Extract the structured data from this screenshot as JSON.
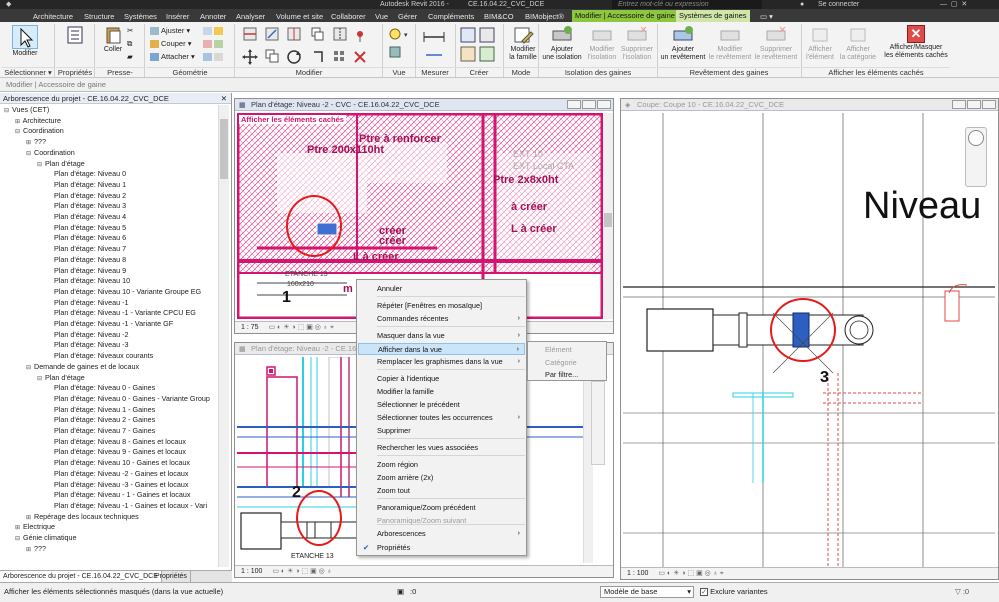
{
  "titlebar": {
    "app_title": "Autodesk Revit 2016 -",
    "file_name": "CE.16.04.22_CVC_DCE",
    "search_placeholder": "Entrez mot-clé ou expression",
    "signin": "Se connecter"
  },
  "tabs": [
    "Architecture",
    "Structure",
    "Systèmes",
    "Insérer",
    "Annoter",
    "Analyser",
    "Volume et site",
    "Collaborer",
    "Vue",
    "Gérer",
    "Compléments",
    "BIM&CO",
    "BIMobject®",
    "Modifier | Accessoire de gaine",
    "Systèmes de gaines"
  ],
  "ribbon": {
    "modify": "Modifier",
    "selection": "Sélectionner",
    "properties": "Propriétés",
    "clipboard": "Presse-papiers",
    "geometry": "Géométrie",
    "modify_panel": "Modifier",
    "view": "Vue",
    "measure": "Mesurer",
    "create": "Créer",
    "mode": "Mode",
    "insulation_panel": "Isolation des gaines",
    "lining_panel": "Revêtement des gaines",
    "hidden_panel": "Afficher les éléments cachés",
    "paste": "Coller",
    "cut": "Couper",
    "fit": "Ajuster",
    "attach": "Attacher",
    "edit_family_1": "Modifier",
    "edit_family_2": "la famille",
    "add_insul_1": "Ajouter",
    "add_insul_2": "une isolation",
    "mod_insul_1": "Modifier",
    "mod_insul_2": "l'isolation",
    "del_insul_1": "Supprimer",
    "del_insul_2": "l'isolation",
    "add_lining_1": "Ajouter",
    "add_lining_2": "un revêtement",
    "mod_lining_1": "Modifier",
    "mod_lining_2": "le revêtement",
    "del_lining_1": "Supprimer",
    "del_lining_2": "le revêtement",
    "show_elem_1": "Afficher",
    "show_elem_2": "l'élément",
    "show_cat_1": "Afficher",
    "show_cat_2": "la catégorie",
    "toggle_hidden_1": "Afficher/Masquer",
    "toggle_hidden_2": "les éléments cachés"
  },
  "optbar": "Modifier | Accessoire de gaine",
  "browser": {
    "title": "Arborescence du projet - CE.16.04.22_CVC_DCE",
    "items": [
      {
        "label": "Vues (CET)",
        "depth": 0,
        "tw": "⊟"
      },
      {
        "label": "Architecture",
        "depth": 1,
        "tw": "⊞"
      },
      {
        "label": "Coordination",
        "depth": 1,
        "tw": "⊟"
      },
      {
        "label": "???",
        "depth": 2,
        "tw": "⊞"
      },
      {
        "label": "Coordination",
        "depth": 2,
        "tw": "⊟"
      },
      {
        "label": "Plan d'étage",
        "depth": 3,
        "tw": "⊟"
      },
      {
        "label": "Plan d'étage: Niveau 0",
        "depth": 4,
        "tw": ""
      },
      {
        "label": "Plan d'étage: Niveau 1",
        "depth": 4,
        "tw": ""
      },
      {
        "label": "Plan d'étage: Niveau 2",
        "depth": 4,
        "tw": ""
      },
      {
        "label": "Plan d'étage: Niveau 3",
        "depth": 4,
        "tw": ""
      },
      {
        "label": "Plan d'étage: Niveau 4",
        "depth": 4,
        "tw": ""
      },
      {
        "label": "Plan d'étage: Niveau 5",
        "depth": 4,
        "tw": ""
      },
      {
        "label": "Plan d'étage: Niveau 6",
        "depth": 4,
        "tw": ""
      },
      {
        "label": "Plan d'étage: Niveau 7",
        "depth": 4,
        "tw": ""
      },
      {
        "label": "Plan d'étage: Niveau 8",
        "depth": 4,
        "tw": ""
      },
      {
        "label": "Plan d'étage: Niveau 9",
        "depth": 4,
        "tw": ""
      },
      {
        "label": "Plan d'étage: Niveau 10",
        "depth": 4,
        "tw": ""
      },
      {
        "label": "Plan d'étage: Niveau 10 - Variante Groupe EG",
        "depth": 4,
        "tw": ""
      },
      {
        "label": "Plan d'étage: Niveau -1",
        "depth": 4,
        "tw": ""
      },
      {
        "label": "Plan d'étage: Niveau -1 - Variante CPCU EG",
        "depth": 4,
        "tw": ""
      },
      {
        "label": "Plan d'étage: Niveau -1 - Variante GF",
        "depth": 4,
        "tw": ""
      },
      {
        "label": "Plan d'étage: Niveau -2",
        "depth": 4,
        "tw": ""
      },
      {
        "label": "Plan d'étage: Niveau -3",
        "depth": 4,
        "tw": ""
      },
      {
        "label": "Plan d'étage: Niveaux courants",
        "depth": 4,
        "tw": ""
      },
      {
        "label": "Demande de gaines et de locaux",
        "depth": 2,
        "tw": "⊟"
      },
      {
        "label": "Plan d'étage",
        "depth": 3,
        "tw": "⊟"
      },
      {
        "label": "Plan d'étage: Niveau 0 - Gaines",
        "depth": 4,
        "tw": ""
      },
      {
        "label": "Plan d'étage: Niveau 0 - Gaines - Variante Group",
        "depth": 4,
        "tw": ""
      },
      {
        "label": "Plan d'étage: Niveau 1 - Gaines",
        "depth": 4,
        "tw": ""
      },
      {
        "label": "Plan d'étage: Niveau 2 - Gaines",
        "depth": 4,
        "tw": ""
      },
      {
        "label": "Plan d'étage: Niveau 7 - Gaines",
        "depth": 4,
        "tw": ""
      },
      {
        "label": "Plan d'étage: Niveau 8 - Gaines et locaux",
        "depth": 4,
        "tw": ""
      },
      {
        "label": "Plan d'étage: Niveau 9 - Gaines et locaux",
        "depth": 4,
        "tw": ""
      },
      {
        "label": "Plan d'étage: Niveau 10 - Gaines et locaux",
        "depth": 4,
        "tw": ""
      },
      {
        "label": "Plan d'étage: Niveau -2 - Gaines et locaux",
        "depth": 4,
        "tw": ""
      },
      {
        "label": "Plan d'étage: Niveau -3 - Gaines et locaux",
        "depth": 4,
        "tw": ""
      },
      {
        "label": "Plan d'étage: Niveau - 1 - Gaines et locaux",
        "depth": 4,
        "tw": ""
      },
      {
        "label": "Plan d'étage: Niveau -1 - Gaines et locaux - Vari",
        "depth": 4,
        "tw": ""
      },
      {
        "label": "Repérage des locaux techniques",
        "depth": 2,
        "tw": "⊞"
      },
      {
        "label": "Electrique",
        "depth": 1,
        "tw": "⊞"
      },
      {
        "label": "Génie climatique",
        "depth": 1,
        "tw": "⊟"
      },
      {
        "label": "???",
        "depth": 2,
        "tw": "⊞"
      }
    ],
    "tab_browser": "Arborescence du projet - CE.16.04.22_CVC_DCE",
    "tab_props": "Propriétés"
  },
  "views": {
    "v1_title": "Plan d'étage: Niveau -2 - CVC - CE.16.04.22_CVC_DCE",
    "v1_banner": "Afficher les éléments cachés",
    "v1_scale": "1 : 75",
    "v1_t1": "Ptre à renforcer",
    "v1_t2": "Ptre 200x110ht",
    "v1_t3": "créer",
    "v1_t4": "créer",
    "v1_t5": "L à créer",
    "v1_t6": "à créer",
    "v1_t7": "L à créer",
    "v1_t8": "EXT 10",
    "v1_t9": "EXT Local CTA",
    "v1_t10": "Ptre 2x8x0ht",
    "v1_t11": "ETANCHE 13",
    "v1_t12": "160x210",
    "v1_t13": "m",
    "v2_title": "Plan d'étage: Niveau -2 - CE.16.04.22_CVC_DCE",
    "v2_scale": "1 : 100",
    "v2_t1": "ETANCHE 13",
    "v3_title": "Coupe: Coupe 10 - CE.16.04.22_CVC_DCE",
    "v3_scale": "1 : 100",
    "v3_level": "Niveau"
  },
  "annotations": {
    "n1": "1",
    "n2": "2",
    "n3": "3"
  },
  "context_menu": {
    "items": [
      {
        "label": "Annuler",
        "sub": false,
        "hl": false
      },
      {
        "label": "Répéter [Fenêtres en mosaïque]",
        "sub": false,
        "hl": false
      },
      {
        "label": "Commandes récentes",
        "sub": true,
        "hl": false
      },
      {
        "label": "Masquer dans la vue",
        "sub": true,
        "hl": false
      },
      {
        "label": "Afficher dans la vue",
        "sub": true,
        "hl": true
      },
      {
        "label": "Remplacer les graphismes dans la vue",
        "sub": true,
        "hl": false
      },
      {
        "label": "Copier à l'identique",
        "sub": false,
        "hl": false
      },
      {
        "label": "Modifier la famille",
        "sub": false,
        "hl": false
      },
      {
        "label": "Sélectionner le précédent",
        "sub": false,
        "hl": false
      },
      {
        "label": "Sélectionner toutes les occurrences",
        "sub": true,
        "hl": false
      },
      {
        "label": "Supprimer",
        "sub": false,
        "hl": false
      },
      {
        "label": "Rechercher les vues associées",
        "sub": false,
        "hl": false
      },
      {
        "label": "Zoom région",
        "sub": false,
        "hl": false
      },
      {
        "label": "Zoom arrière (2x)",
        "sub": false,
        "hl": false
      },
      {
        "label": "Zoom tout",
        "sub": false,
        "hl": false
      },
      {
        "label": "Panoramique/Zoom précédent",
        "sub": false,
        "hl": false
      },
      {
        "label": "Panoramique/Zoom suivant",
        "sub": false,
        "hl": false,
        "dis": true
      },
      {
        "label": "Arborescences",
        "sub": true,
        "hl": false
      },
      {
        "label": "Propriétés",
        "sub": false,
        "hl": false,
        "check": true
      }
    ],
    "submenu": [
      {
        "label": "Elément",
        "dis": true
      },
      {
        "label": "Catégorie",
        "dis": true
      },
      {
        "label": "Par filtre...",
        "dis": false
      }
    ]
  },
  "status": {
    "message": "Afficher les éléments sélectionnés masqués (dans la vue actuelle)",
    "zero": ":0",
    "model": "Modèle de base",
    "variants": "Exclure variantes"
  },
  "colors": {
    "accent": "#8ec63f",
    "magenta": "#d4146f",
    "annotation": "#e51a1a",
    "highlight": "#cce4f7"
  }
}
